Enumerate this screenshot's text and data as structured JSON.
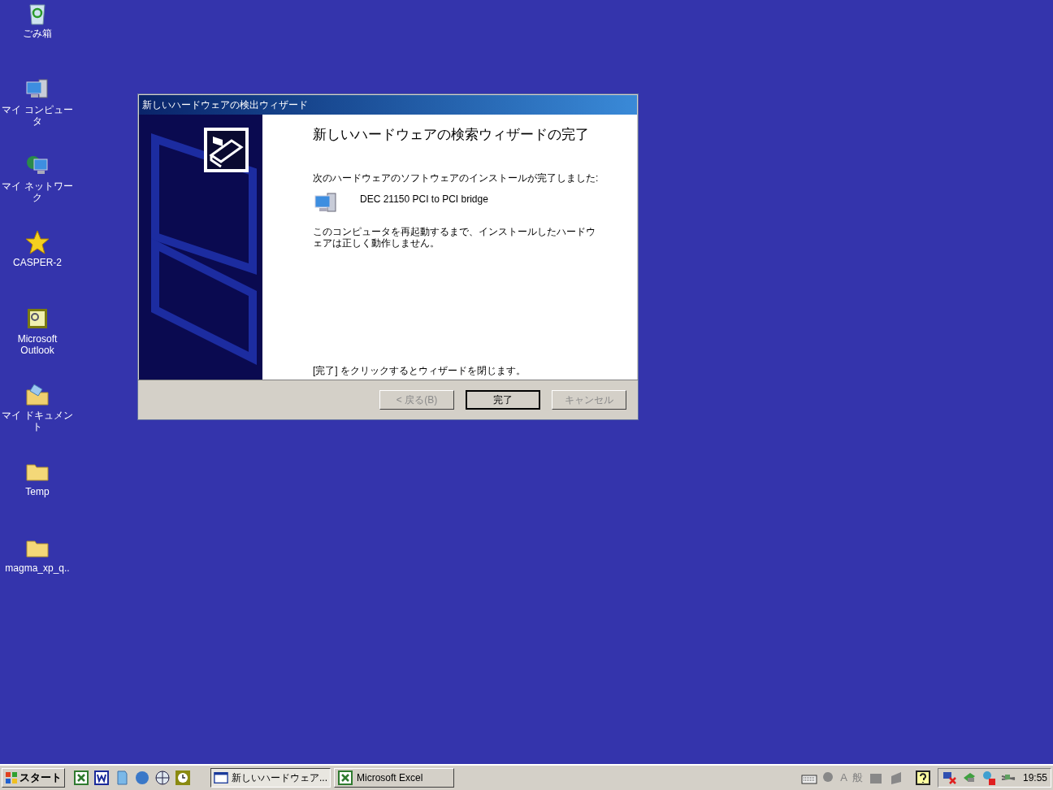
{
  "desktop_icons": [
    {
      "label": "ごみ箱",
      "kind": "trash"
    },
    {
      "label": "マイ コンピュータ",
      "kind": "computer"
    },
    {
      "label": "マイ ネットワーク",
      "kind": "network"
    },
    {
      "label": "CASPER-2",
      "kind": "star"
    },
    {
      "label": "Microsoft Outlook",
      "kind": "outlook"
    },
    {
      "label": "マイ ドキュメント",
      "kind": "documents"
    },
    {
      "label": "Temp",
      "kind": "folder"
    },
    {
      "label": "magma_xp_q..",
      "kind": "folder"
    }
  ],
  "dialog": {
    "title": "新しいハードウェアの検出ウィザード",
    "heading": "新しいハードウェアの検索ウィザードの完了",
    "intro": "次のハードウェアのソフトウェアのインストールが完了しました:",
    "device": "DEC 21150 PCI to PCI bridge",
    "note": "このコンピュータを再起動するまで、インストールしたハードウェアは正しく動作しません。",
    "footer": "[完了] をクリックするとウィザードを閉じます。",
    "buttons": [
      {
        "label": "< 戻る(B)",
        "disabled": true,
        "default": false
      },
      {
        "label": "完了",
        "disabled": false,
        "default": true
      },
      {
        "label": "キャンセル",
        "disabled": true,
        "default": false
      }
    ]
  },
  "taskbar": {
    "start": "スタート",
    "quick_launch": [
      {
        "kind": "excel"
      },
      {
        "kind": "word"
      },
      {
        "kind": "page"
      },
      {
        "kind": "ie"
      },
      {
        "kind": "globe"
      },
      {
        "kind": "clock"
      }
    ],
    "tasks": [
      {
        "label": "新しいハードウェア...",
        "kind": "window",
        "selected": true
      },
      {
        "label": "Microsoft Excel",
        "kind": "excel",
        "selected": false
      }
    ],
    "language_bar": {
      "mode": "A",
      "input": "般"
    },
    "clock": "19:55"
  }
}
